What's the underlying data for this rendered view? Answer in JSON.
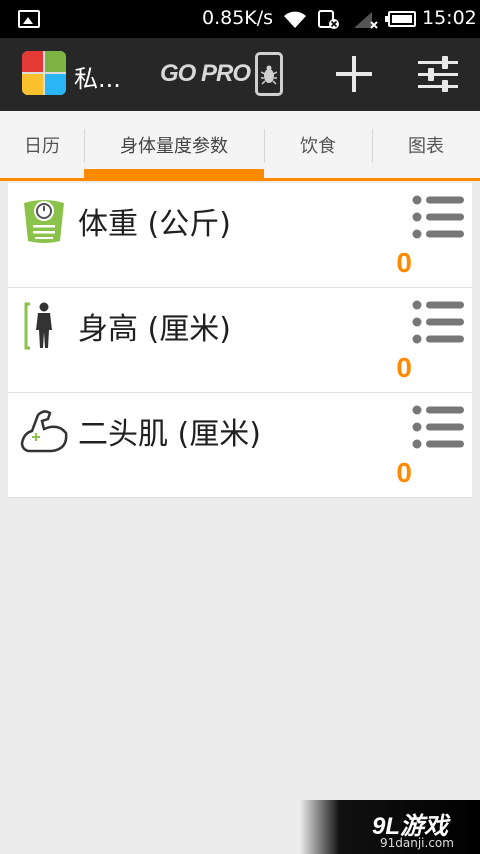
{
  "status_bar": {
    "net_speed": "0.85K/s",
    "time": "15:02",
    "icons": [
      "image-icon",
      "wifi-icon",
      "sim-off-icon",
      "signal-icon",
      "battery-icon"
    ]
  },
  "action_bar": {
    "app_title": "私...",
    "go_pro_label": "GO PRO",
    "icons": [
      "app-logo-icon",
      "bug-phone-icon",
      "plus-icon",
      "sliders-icon"
    ]
  },
  "tabs": [
    {
      "label": "日历",
      "active": false
    },
    {
      "label": "身体量度参数",
      "active": true
    },
    {
      "label": "饮食",
      "active": false
    },
    {
      "label": "图表",
      "active": false
    }
  ],
  "measurements": [
    {
      "label": "体重 (公斤)",
      "value": "0",
      "icon": "scale-icon"
    },
    {
      "label": "身高 (厘米)",
      "value": "0",
      "icon": "body-height-icon"
    },
    {
      "label": "二头肌 (厘米)",
      "value": "0",
      "icon": "biceps-icon"
    }
  ],
  "watermark": {
    "main": "9L游戏",
    "sub": "91danji.com"
  },
  "colors": {
    "accent": "#ff8a00",
    "action_bar": "#272727",
    "status_bar": "#000000",
    "icon_green": "#8bc34a"
  }
}
